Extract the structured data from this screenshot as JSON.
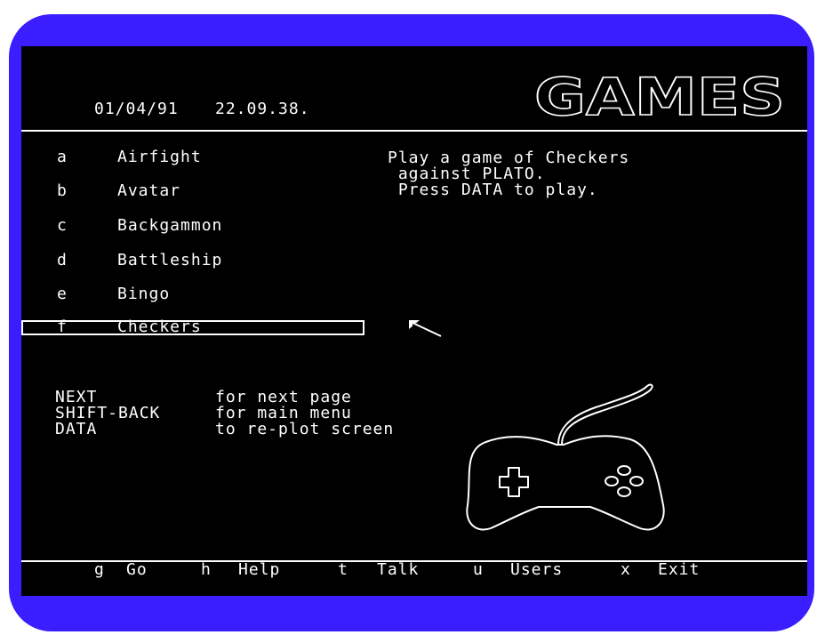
{
  "header": {
    "date": "01/04/91",
    "time": "22.09.38.",
    "logo": "GAMES"
  },
  "menu": {
    "items": [
      {
        "key": "a",
        "label": "Airfight"
      },
      {
        "key": "b",
        "label": "Avatar"
      },
      {
        "key": "c",
        "label": "Backgammon"
      },
      {
        "key": "d",
        "label": "Battleship"
      },
      {
        "key": "e",
        "label": "Bingo"
      },
      {
        "key": "f",
        "label": "Checkers"
      }
    ],
    "selected_key": "f"
  },
  "description": {
    "lines": [
      "Play a game of Checkers",
      " against PLATO.",
      " Press DATA to play."
    ]
  },
  "help_keys": [
    {
      "key": "NEXT",
      "desc": "for next page"
    },
    {
      "key": "SHIFT-BACK",
      "desc": "for main menu"
    },
    {
      "key": "DATA",
      "desc": "to re-plot screen"
    }
  ],
  "footer": {
    "items": [
      {
        "key": "g",
        "label": "Go"
      },
      {
        "key": "h",
        "label": "Help"
      },
      {
        "key": "t",
        "label": "Talk"
      },
      {
        "key": "u",
        "label": "Users"
      },
      {
        "key": "x",
        "label": "Exit"
      }
    ]
  },
  "icons": {
    "cursor": "arrow-cursor-icon",
    "illustration": "gamepad-icon"
  },
  "colors": {
    "bezel": "#3a1eff",
    "screen": "#000000",
    "text": "#ffffff"
  }
}
